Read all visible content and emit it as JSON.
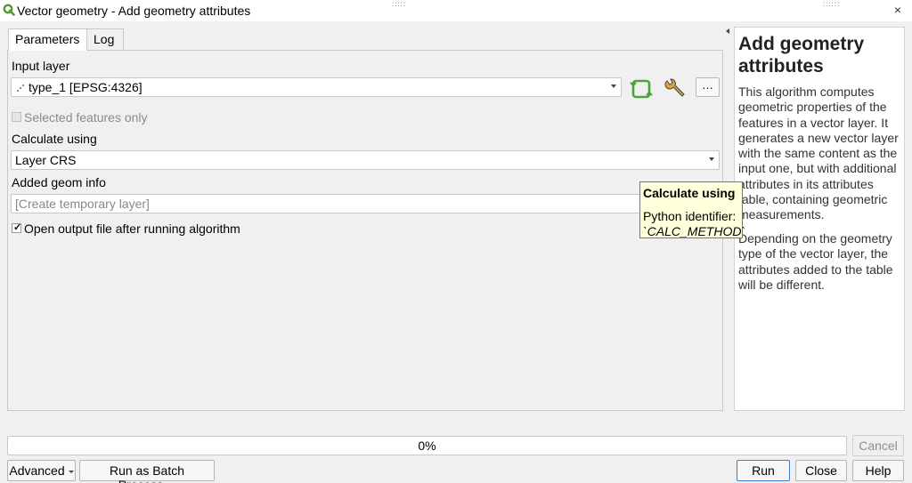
{
  "window": {
    "title": "Vector geometry - Add geometry attributes",
    "close_label": "×"
  },
  "tabs": [
    {
      "label": "Parameters"
    },
    {
      "label": "Log"
    }
  ],
  "params": {
    "input_layer_label": "Input layer",
    "input_layer_value": "type_1 [EPSG:4326]",
    "input_layer_icon": "point-layer-icon",
    "selected_only_label": "Selected features only",
    "selected_only_checked": false,
    "calc_label": "Calculate using",
    "calc_value": "Layer CRS",
    "added_geom_label": "Added geom info",
    "added_geom_placeholder": "[Create temporary layer]",
    "open_output_label": "Open output file after running algorithm",
    "open_output_checked": true,
    "more_button_label": "…"
  },
  "tooltip": {
    "title": "Calculate using",
    "line1": "Python identifier:",
    "code": "`CALC_METHOD`"
  },
  "help": {
    "title": "Add geometry attributes",
    "para1": "This algorithm computes geometric properties of the features in a vector layer. It generates a new vector layer with the same content as the input one, but with additional attributes in its attributes table, containing geometric measurements.",
    "para2": "Depending on the geometry type of the vector layer, the attributes added to the table will be different."
  },
  "progress": {
    "text": "0%",
    "value": 0
  },
  "buttons": {
    "cancel": "Cancel",
    "advanced": "Advanced",
    "batch": "Run as Batch Process…",
    "run": "Run",
    "close": "Close",
    "help": "Help"
  },
  "colors": {
    "qgis_green": "#589632",
    "tooltip_bg": "#ffffdc",
    "default_button_border": "#3c7fd0"
  }
}
